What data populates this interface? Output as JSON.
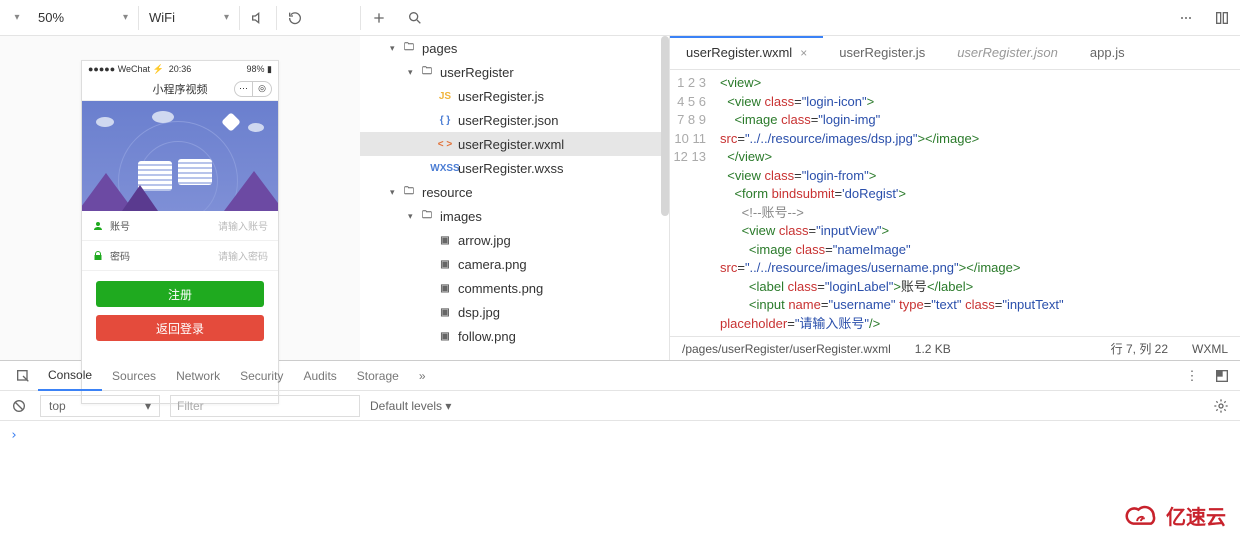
{
  "toolbar": {
    "zoom": "50%",
    "network": "WiFi"
  },
  "phone": {
    "carrier": "WeChat",
    "time": "20:36",
    "battery": "98%",
    "title": "小程序视频",
    "form": {
      "account_label": "账号",
      "account_placeholder": "请输入账号",
      "password_label": "密码",
      "password_placeholder": "请输入密码"
    },
    "buttons": {
      "register": "注册",
      "back_login": "返回登录"
    }
  },
  "tree": {
    "pages": "pages",
    "userRegister": "userRegister",
    "files": {
      "js": "userRegister.js",
      "json": "userRegister.json",
      "wxml": "userRegister.wxml",
      "wxss": "userRegister.wxss"
    },
    "resource": "resource",
    "images": "images",
    "img_files": [
      "arrow.jpg",
      "camera.png",
      "comments.png",
      "dsp.jpg",
      "follow.png"
    ]
  },
  "tabs": [
    {
      "name": "userRegister.wxml",
      "active": true,
      "closeable": true
    },
    {
      "name": "userRegister.js",
      "active": false
    },
    {
      "name": "userRegister.json",
      "active": false,
      "unsaved": true
    },
    {
      "name": "app.js",
      "active": false
    }
  ],
  "code_lines": [
    1,
    2,
    3,
    4,
    5,
    6,
    7,
    8,
    9,
    10,
    11,
    12,
    13
  ],
  "status": {
    "path": "/pages/userRegister/userRegister.wxml",
    "size": "1.2 KB",
    "cursor": "行 7, 列 22",
    "lang": "WXML"
  },
  "devtools": {
    "tabs": [
      "Console",
      "Sources",
      "Network",
      "Security",
      "Audits",
      "Storage"
    ],
    "context": "top",
    "filter_placeholder": "Filter",
    "levels": "Default levels ▾"
  },
  "watermark": "亿速云"
}
